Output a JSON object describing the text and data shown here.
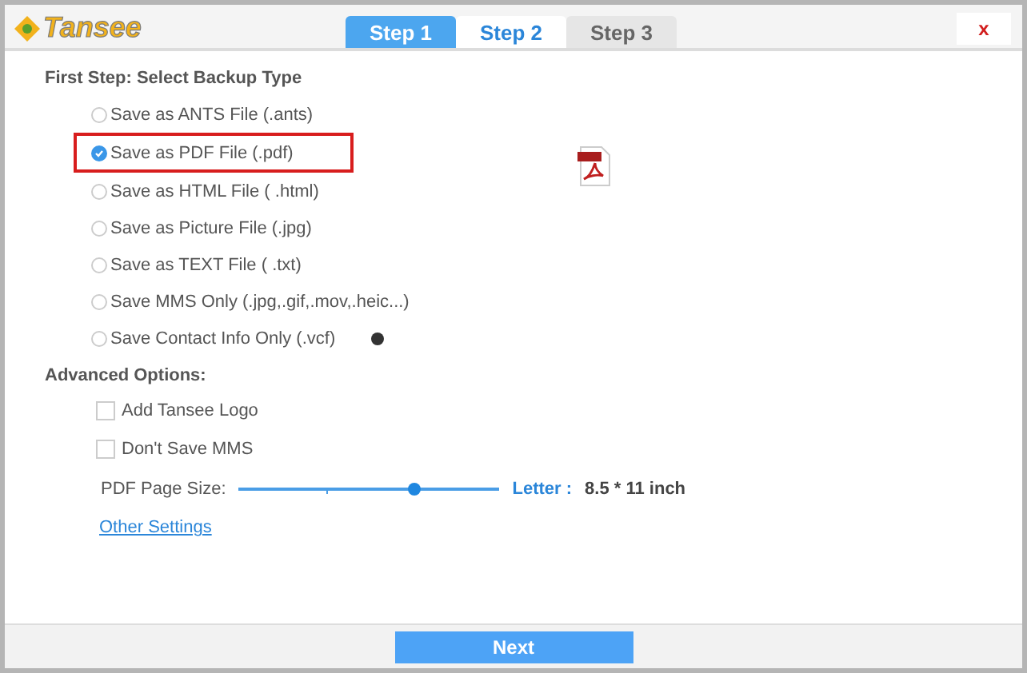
{
  "logo": "Tansee",
  "tabs": [
    {
      "label": "Step 1",
      "selected": true
    },
    {
      "label": "Step 2",
      "selected": false
    },
    {
      "label": "Step 3",
      "selected": false
    }
  ],
  "close": "x",
  "backup_type": {
    "heading": "First Step: Select Backup Type",
    "options": [
      {
        "label": "Save as ANTS File (.ants)",
        "selected": false
      },
      {
        "label": "Save as PDF File (.pdf)",
        "selected": true
      },
      {
        "label": "Save as HTML File ( .html)",
        "selected": false
      },
      {
        "label": "Save as Picture File (.jpg)",
        "selected": false
      },
      {
        "label": "Save as TEXT File ( .txt)",
        "selected": false
      },
      {
        "label": "Save MMS Only (.jpg,.gif,.mov,.heic...)",
        "selected": false
      },
      {
        "label": "Save Contact Info Only (.vcf)",
        "selected": false,
        "help": true
      }
    ]
  },
  "advanced": {
    "heading": "Advanced Options:",
    "checkboxes": [
      {
        "label": "Add Tansee Logo",
        "checked": false
      },
      {
        "label": "Don't Save MMS",
        "checked": false
      }
    ],
    "page_size": {
      "label": "PDF Page Size:",
      "level": 0.675,
      "name": "Letter :",
      "value": "8.5 * 11 inch"
    },
    "link": "Other Settings"
  },
  "next": "Next"
}
